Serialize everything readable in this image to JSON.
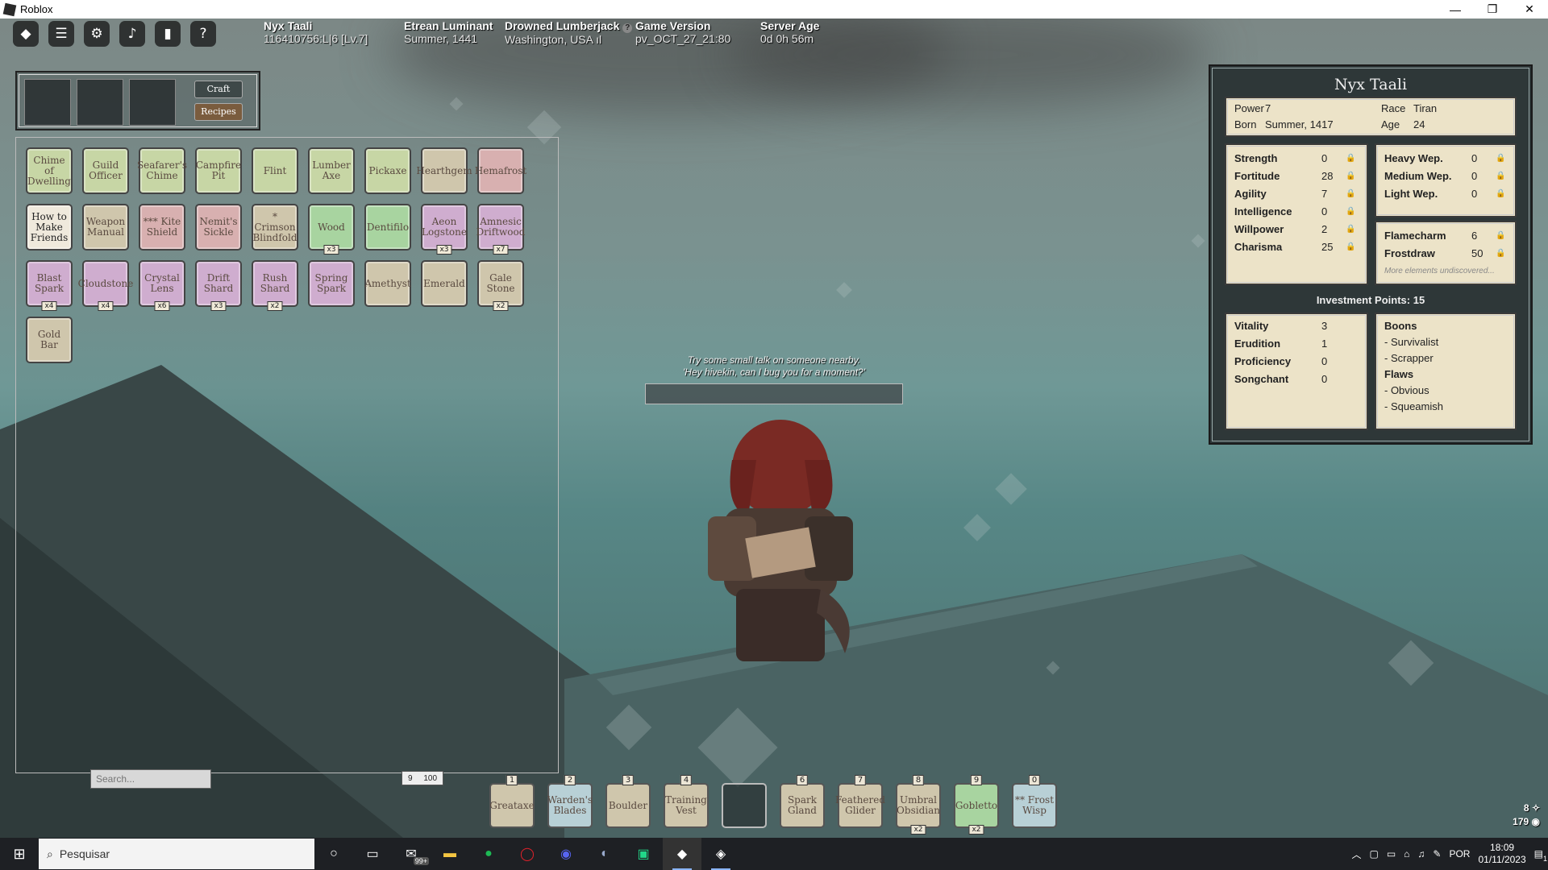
{
  "window": {
    "title": "Roblox",
    "min": "—",
    "max": "❐",
    "close": "✕"
  },
  "topbar": {
    "player_name": "Nyx Taali",
    "player_id": "116410756:L|6 [Lv.7]",
    "faction": "Etrean Luminant",
    "date": "Summer, 1441",
    "server": "Drowned Lumberjack",
    "location": "Washington, USA ıl",
    "version_label": "Game Version",
    "version": "pv_OCT_27_21:80",
    "age_label": "Server Age",
    "age": "0d 0h 56m"
  },
  "craft": {
    "craft_label": "Craft",
    "recipes_label": "Recipes"
  },
  "inventory": {
    "items": [
      {
        "label": "Chime of Dwelling",
        "color": "green",
        "qty": ""
      },
      {
        "label": "Guild Officer",
        "color": "green",
        "qty": ""
      },
      {
        "label": "Seafarer's Chime",
        "color": "green",
        "qty": ""
      },
      {
        "label": "Campfire Pit",
        "color": "green",
        "qty": ""
      },
      {
        "label": "Flint",
        "color": "green",
        "qty": ""
      },
      {
        "label": "Lumber Axe",
        "color": "green",
        "qty": ""
      },
      {
        "label": "Pickaxe",
        "color": "green",
        "qty": ""
      },
      {
        "label": "Hearthgem",
        "color": "tan",
        "qty": ""
      },
      {
        "label": "Hemafrost",
        "color": "pink",
        "qty": ""
      },
      {
        "label": "How to Make Friends",
        "color": "white",
        "qty": ""
      },
      {
        "label": "Weapon Manual",
        "color": "tan",
        "qty": ""
      },
      {
        "label": "*** Kite Shield",
        "color": "pink",
        "qty": ""
      },
      {
        "label": "Nemit's Sickle",
        "color": "pink",
        "qty": ""
      },
      {
        "label": "* Crimson Blindfold",
        "color": "tan",
        "qty": ""
      },
      {
        "label": "Wood",
        "color": "green2",
        "qty": "x3"
      },
      {
        "label": "Dentifilo",
        "color": "green2",
        "qty": ""
      },
      {
        "label": "Aeon Logstone",
        "color": "purple",
        "qty": "x3"
      },
      {
        "label": "Amnesic Driftwood",
        "color": "purple",
        "qty": "x7"
      },
      {
        "label": "Blast Spark",
        "color": "purple",
        "qty": "x4"
      },
      {
        "label": "Cloudstone",
        "color": "purple",
        "qty": "x4"
      },
      {
        "label": "Crystal Lens",
        "color": "purple",
        "qty": "x6"
      },
      {
        "label": "Drift Shard",
        "color": "purple",
        "qty": "x3"
      },
      {
        "label": "Rush Shard",
        "color": "purple",
        "qty": "x2"
      },
      {
        "label": "Spring Spark",
        "color": "purple",
        "qty": ""
      },
      {
        "label": "Amethyst",
        "color": "tan",
        "qty": ""
      },
      {
        "label": "Emerald",
        "color": "tan",
        "qty": ""
      },
      {
        "label": "Gale Stone",
        "color": "tan",
        "qty": "x2"
      },
      {
        "label": "Gold Bar",
        "color": "tan",
        "qty": ""
      }
    ],
    "search_placeholder": "Search...",
    "weight_current": "9",
    "weight_max": "100"
  },
  "character": {
    "name": "Nyx Taali",
    "power_label": "Power",
    "power": "7",
    "race_label": "Race",
    "race": "Tiran",
    "born_label": "Born",
    "born": "Summer, 1417",
    "age_label": "Age",
    "age": "24",
    "attributes": [
      {
        "label": "Strength",
        "value": "0"
      },
      {
        "label": "Fortitude",
        "value": "28"
      },
      {
        "label": "Agility",
        "value": "7"
      },
      {
        "label": "Intelligence",
        "value": "0"
      },
      {
        "label": "Willpower",
        "value": "2"
      },
      {
        "label": "Charisma",
        "value": "25"
      }
    ],
    "weapons": [
      {
        "label": "Heavy Wep.",
        "value": "0"
      },
      {
        "label": "Medium Wep.",
        "value": "0"
      },
      {
        "label": "Light Wep.",
        "value": "0"
      }
    ],
    "elements": [
      {
        "label": "Flamecharm",
        "value": "6"
      },
      {
        "label": "Frostdraw",
        "value": "50"
      }
    ],
    "elements_more": "More elements undiscovered...",
    "investment": "Investment Points: 15",
    "investments": [
      {
        "label": "Vitality",
        "value": "3"
      },
      {
        "label": "Erudition",
        "value": "1"
      },
      {
        "label": "Proficiency",
        "value": "0"
      },
      {
        "label": "Songchant",
        "value": "0"
      }
    ],
    "boons_label": "Boons",
    "boons": [
      "- Survivalist",
      "- Scrapper"
    ],
    "flaws_label": "Flaws",
    "flaws": [
      "- Obvious",
      "- Squeamish"
    ]
  },
  "dialog": {
    "line1": "Try some small talk on someone nearby.",
    "line2": "'Hey hivekin, can I bug you for a moment?'"
  },
  "hotbar": [
    {
      "key": "1",
      "label": "Greataxe",
      "color": "tan",
      "qty": ""
    },
    {
      "key": "2",
      "label": "Warden's Blades",
      "color": "blue",
      "qty": ""
    },
    {
      "key": "3",
      "label": "Boulder",
      "color": "tan",
      "qty": ""
    },
    {
      "key": "4",
      "label": "Training Vest",
      "color": "tan",
      "qty": ""
    },
    {
      "key": "",
      "label": "",
      "color": "empty",
      "qty": ""
    },
    {
      "key": "6",
      "label": "Spark Gland",
      "color": "tan",
      "qty": ""
    },
    {
      "key": "7",
      "label": "Feathered Glider",
      "color": "tan",
      "qty": ""
    },
    {
      "key": "8",
      "label": "Umbral Obsidian",
      "color": "tan",
      "qty": "x2"
    },
    {
      "key": "9",
      "label": "Gobletto",
      "color": "green",
      "qty": "x2"
    },
    {
      "key": "0",
      "label": "** Frost Wisp",
      "color": "blue",
      "qty": ""
    }
  ],
  "status_br": {
    "level": "8",
    "currency": "179"
  },
  "taskbar": {
    "search_placeholder": "Pesquisar",
    "mail_badge": "99+",
    "lang": "POR",
    "time": "18:09",
    "date": "01/11/2023",
    "notif": "1"
  }
}
